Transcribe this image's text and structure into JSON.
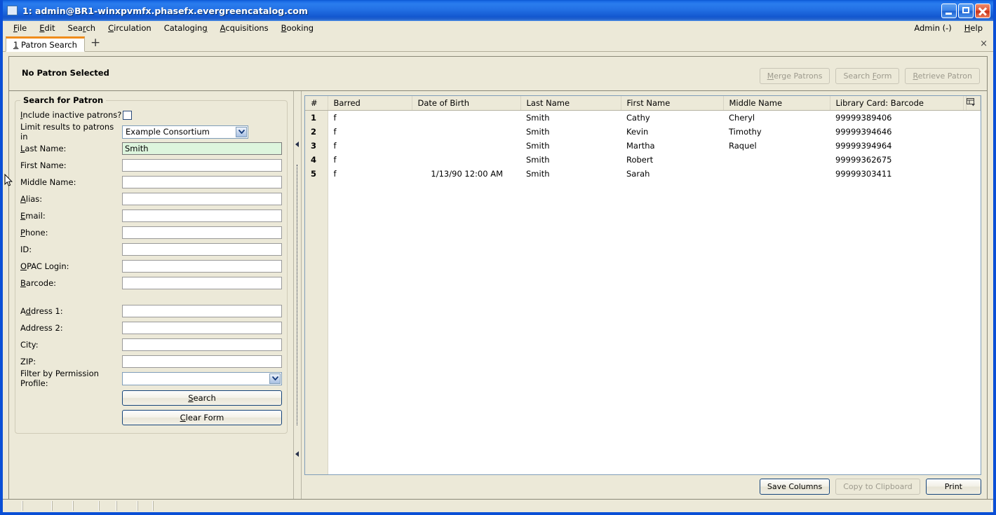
{
  "window": {
    "title": "1: admin@BR1-winxpvmfx.phasefx.evergreencatalog.com",
    "icon": "app-icon",
    "minimize_label": "Minimize",
    "maximize_label": "Maximize",
    "close_label": "Close",
    "titlebar_color": "#2472e6",
    "chrome_color": "#ece9d8"
  },
  "menubar": {
    "items": [
      {
        "label": "File",
        "mnemonic": "F"
      },
      {
        "label": "Edit",
        "mnemonic": "E"
      },
      {
        "label": "Search",
        "mnemonic": "r"
      },
      {
        "label": "Circulation",
        "mnemonic": "C"
      },
      {
        "label": "Cataloging",
        "mnemonic": "g"
      },
      {
        "label": "Acquisitions",
        "mnemonic": "A"
      },
      {
        "label": "Booking",
        "mnemonic": "B"
      }
    ],
    "right_items": [
      {
        "label": "Admin (-)",
        "mnemonic": ""
      },
      {
        "label": "Help",
        "mnemonic": "H"
      }
    ]
  },
  "tabbar": {
    "active_tab_number": "1",
    "active_tab_label": "Patron Search",
    "new_tab_label": "+",
    "close_tab_label": "×",
    "active_tab_accent": "#f08c1b"
  },
  "patron_header": {
    "status": "No Patron Selected",
    "buttons": [
      {
        "label": "Merge Patrons",
        "mnemonic": "M",
        "enabled": false
      },
      {
        "label": "Search Form",
        "mnemonic": "F",
        "enabled": false
      },
      {
        "label": "Retrieve Patron",
        "mnemonic": "R",
        "enabled": false
      }
    ]
  },
  "search_form": {
    "legend": "Search for Patron",
    "include_inactive": {
      "label": "Include inactive patrons?",
      "mnemonic": "I",
      "checked": false
    },
    "limit_results": {
      "label": "Limit results to patrons in",
      "value": "Example Consortium"
    },
    "fields": [
      {
        "label": "Last Name:",
        "mnemonic": "L",
        "value": "Smith",
        "placeholder": "",
        "focused": true
      },
      {
        "label": "First Name:",
        "mnemonic": "",
        "value": "",
        "placeholder": "",
        "focused": false
      },
      {
        "label": "Middle Name:",
        "mnemonic": "",
        "value": "",
        "placeholder": "",
        "focused": false
      },
      {
        "label": "Alias:",
        "mnemonic": "A",
        "value": "",
        "placeholder": "",
        "focused": false
      },
      {
        "label": "Email:",
        "mnemonic": "E",
        "value": "",
        "placeholder": "",
        "focused": false
      },
      {
        "label": "Phone:",
        "mnemonic": "P",
        "value": "",
        "placeholder": "",
        "focused": false
      },
      {
        "label": "ID:",
        "mnemonic": "",
        "value": "",
        "placeholder": "",
        "focused": false
      },
      {
        "label": "OPAC Login:",
        "mnemonic": "O",
        "value": "",
        "placeholder": "",
        "focused": false
      },
      {
        "label": "Barcode:",
        "mnemonic": "B",
        "value": "",
        "placeholder": "",
        "focused": false
      }
    ],
    "address_fields": [
      {
        "label": "Address 1:",
        "mnemonic": "d",
        "value": "",
        "placeholder": ""
      },
      {
        "label": "Address 2:",
        "mnemonic": "",
        "value": "",
        "placeholder": ""
      },
      {
        "label": "City:",
        "mnemonic": "",
        "value": "",
        "placeholder": ""
      },
      {
        "label": "ZIP:",
        "mnemonic": "",
        "value": "",
        "placeholder": ""
      }
    ],
    "permission_profile": {
      "label": "Filter by Permission Profile:",
      "value": ""
    },
    "search_button": {
      "label": "Search",
      "mnemonic": "S"
    },
    "clear_button": {
      "label": "Clear Form",
      "mnemonic": "C"
    }
  },
  "results": {
    "columns": [
      "#",
      "Barred",
      "Date of Birth",
      "Last Name",
      "First Name",
      "Middle Name",
      "Library Card: Barcode"
    ],
    "column_picker_icon": "column-picker-icon",
    "rows": [
      {
        "num": "1",
        "barred": "f",
        "dob": "",
        "last": "Smith",
        "first": "Cathy",
        "middle": "Cheryl",
        "barcode": "99999389406"
      },
      {
        "num": "2",
        "barred": "f",
        "dob": "",
        "last": "Smith",
        "first": "Kevin",
        "middle": "Timothy",
        "barcode": "99999394646"
      },
      {
        "num": "3",
        "barred": "f",
        "dob": "",
        "last": "Smith",
        "first": "Martha",
        "middle": "Raquel",
        "barcode": "99999394964"
      },
      {
        "num": "4",
        "barred": "f",
        "dob": "",
        "last": "Smith",
        "first": "Robert",
        "middle": "",
        "barcode": "99999362675"
      },
      {
        "num": "5",
        "barred": "f",
        "dob": "1/13/90 12:00 AM",
        "last": "Smith",
        "first": "Sarah",
        "middle": "",
        "barcode": "99999303411"
      }
    ],
    "footer_buttons": [
      {
        "label": "Save Columns",
        "enabled": true
      },
      {
        "label": "Copy to Clipboard",
        "enabled": false
      },
      {
        "label": "Print",
        "enabled": true
      }
    ]
  },
  "statusbar": {
    "cells": [
      "",
      "",
      "",
      "",
      "",
      "",
      "",
      ""
    ]
  }
}
